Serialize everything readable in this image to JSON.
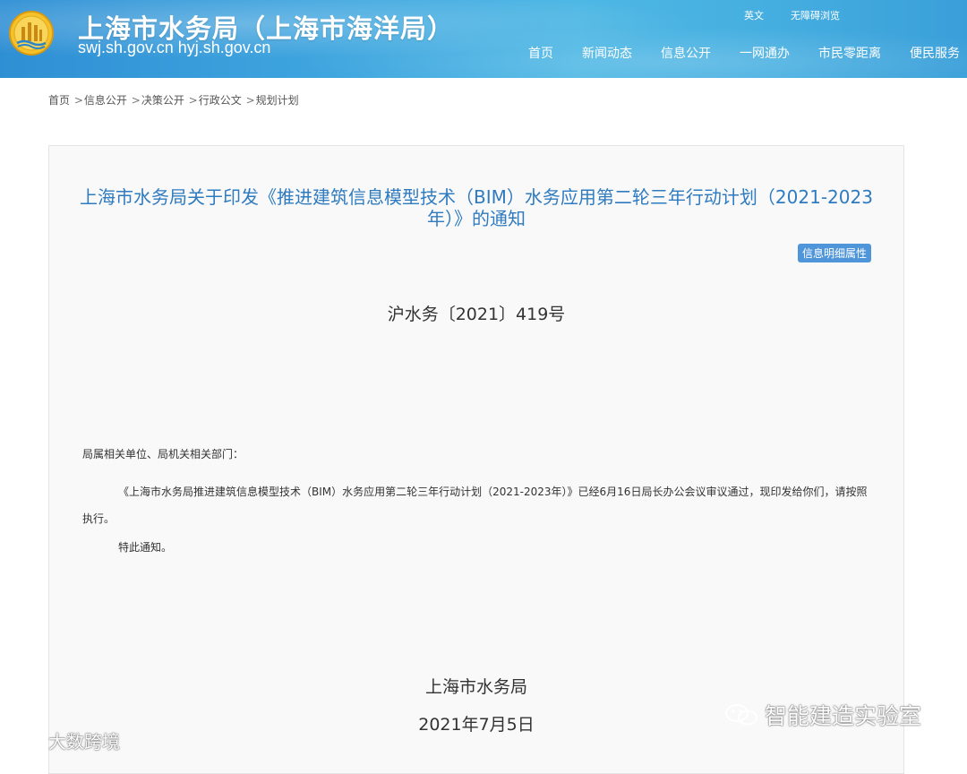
{
  "header": {
    "title": "上海市水务局（上海市海洋局）",
    "domains": "swj.sh.gov.cn  hyj.sh.gov.cn",
    "top_links": [
      "英文",
      "无障碍浏览"
    ],
    "nav": [
      "首页",
      "新闻动态",
      "信息公开",
      "一网通办",
      "市民零距离",
      "便民服务"
    ]
  },
  "breadcrumb": {
    "items": [
      "首页",
      "信息公开",
      "决策公开",
      "行政公文",
      "规划计划"
    ],
    "separator": ">"
  },
  "document": {
    "title": "上海市水务局关于印发《推进建筑信息模型技术（BIM）水务应用第二轮三年行动计划（2021-2023年）》的通知",
    "info_badge": "信息明细属性",
    "doc_number": "沪水务〔2021〕419号",
    "addressee": "局属相关单位、局机关相关部门：",
    "body": "《上海市水务局推进建筑信息模型技术（BIM）水务应用第二轮三年行动计划（2021-2023年）》已经6月16日局长办公会议审议通过，现印发给你们，请按照执行。",
    "closing": "特此通知。",
    "signature": "上海市水务局",
    "date": "2021年7月5日"
  },
  "watermarks": {
    "right": "智能建造实验室",
    "left": "大数跨境"
  },
  "colors": {
    "header_blue": "#3fa6df",
    "title_blue": "#2f7bc0",
    "badge_blue": "#4f95d9"
  }
}
